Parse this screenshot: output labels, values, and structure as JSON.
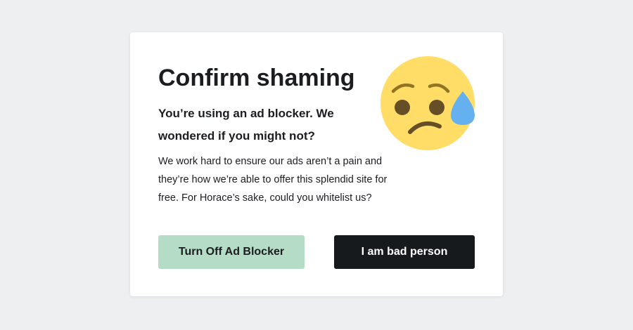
{
  "dialog": {
    "title": "Confirm shaming",
    "subtitle": "You’re using an ad blocker. We wondered if you might not?",
    "body": "We work hard to ensure our ads aren’t a pain and they’re how we’re able to offer this splendid site for free. For Horace’s sake, could you whitelist us?",
    "emoji_icon": "sad-sweat-face-icon",
    "accept_label": "Turn Off Ad Blocker",
    "decline_label": "I am bad person"
  },
  "colors": {
    "background": "#eeeff1",
    "card": "#ffffff",
    "text": "#1b1d21",
    "accept_button": "#b5dcc6",
    "decline_button": "#171a1d",
    "emoji_face": "#ffdd67",
    "emoji_features": "#664e27",
    "sweat_drop": "#65b1ef"
  }
}
